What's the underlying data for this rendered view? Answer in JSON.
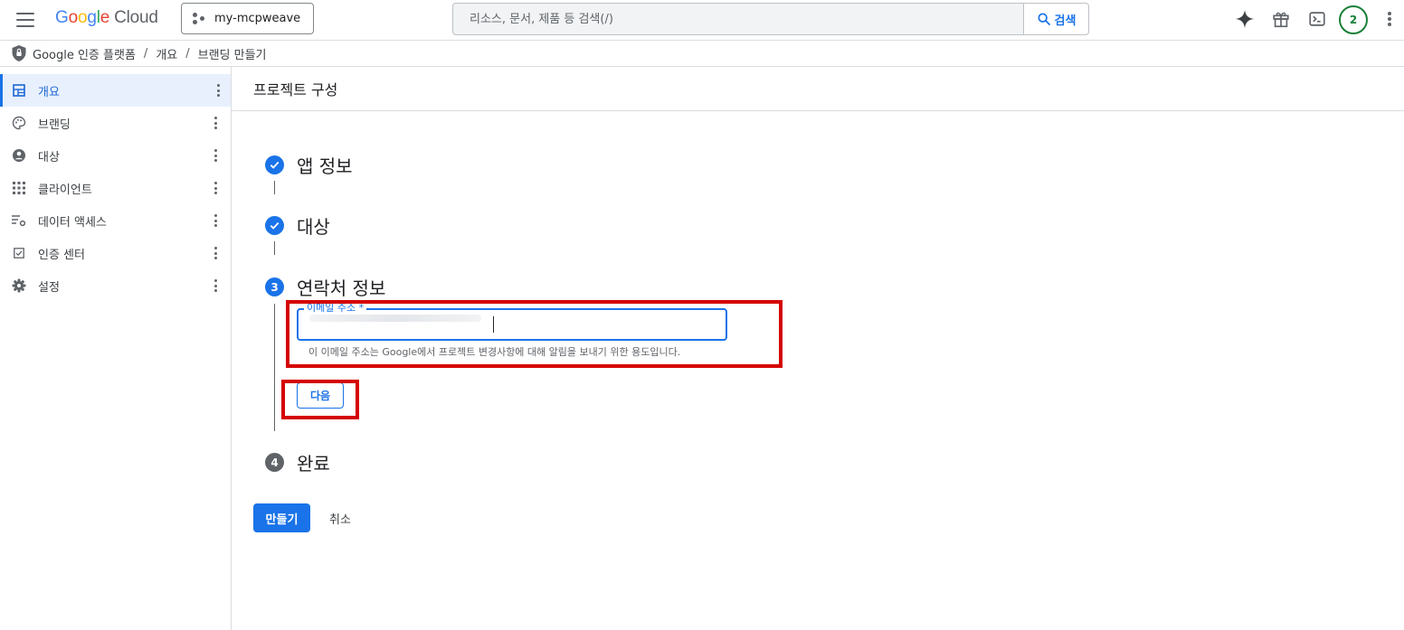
{
  "header": {
    "logo": {
      "g": "G",
      "o1": "o",
      "o2": "o",
      "g2": "g",
      "l": "l",
      "e": "e",
      "cloud": "Cloud"
    },
    "project": "my-mcpweave",
    "search_placeholder": "리소스, 문서, 제품 등 검색(/)",
    "search_button": "검색",
    "avatar_label": "2",
    "icons": [
      "menu-icon",
      "gemini-sparkle-icon",
      "gift-icon",
      "cloud-shell-icon",
      "more-vert-icon"
    ]
  },
  "breadcrumb": {
    "items": [
      "Google 인증 플랫폼",
      "개요",
      "브랜딩 만들기"
    ],
    "separator": "/"
  },
  "sidebar": {
    "items": [
      {
        "label": "개요",
        "icon": "dashboard-icon",
        "active": true
      },
      {
        "label": "브랜딩",
        "icon": "palette-icon"
      },
      {
        "label": "대상",
        "icon": "account-circle-icon"
      },
      {
        "label": "클라이언트",
        "icon": "apps-grid-icon"
      },
      {
        "label": "데이터 액세스",
        "icon": "data-access-icon"
      },
      {
        "label": "인증 센터",
        "icon": "verified-check-icon"
      },
      {
        "label": "설정",
        "icon": "settings-gear-icon"
      }
    ]
  },
  "main": {
    "title": "프로젝트 구성",
    "steps": [
      {
        "label": "앱 정보",
        "status": "done"
      },
      {
        "label": "대상",
        "status": "done"
      },
      {
        "number": "3",
        "label": "연락처 정보",
        "status": "current"
      },
      {
        "number": "4",
        "label": "완료",
        "status": "future"
      }
    ],
    "email": {
      "label": "이메일 주소 *",
      "value": "",
      "hint": "이 이메일 주소는 Google에서 프로젝트 변경사항에 대해 알림을 보내기 위한 용도입니다."
    },
    "next_button": "다음",
    "create_button": "만들기",
    "cancel_button": "취소"
  },
  "colors": {
    "accent": "#1a73e8",
    "highlight": "#d50000",
    "avatar_ring": "#188038"
  }
}
